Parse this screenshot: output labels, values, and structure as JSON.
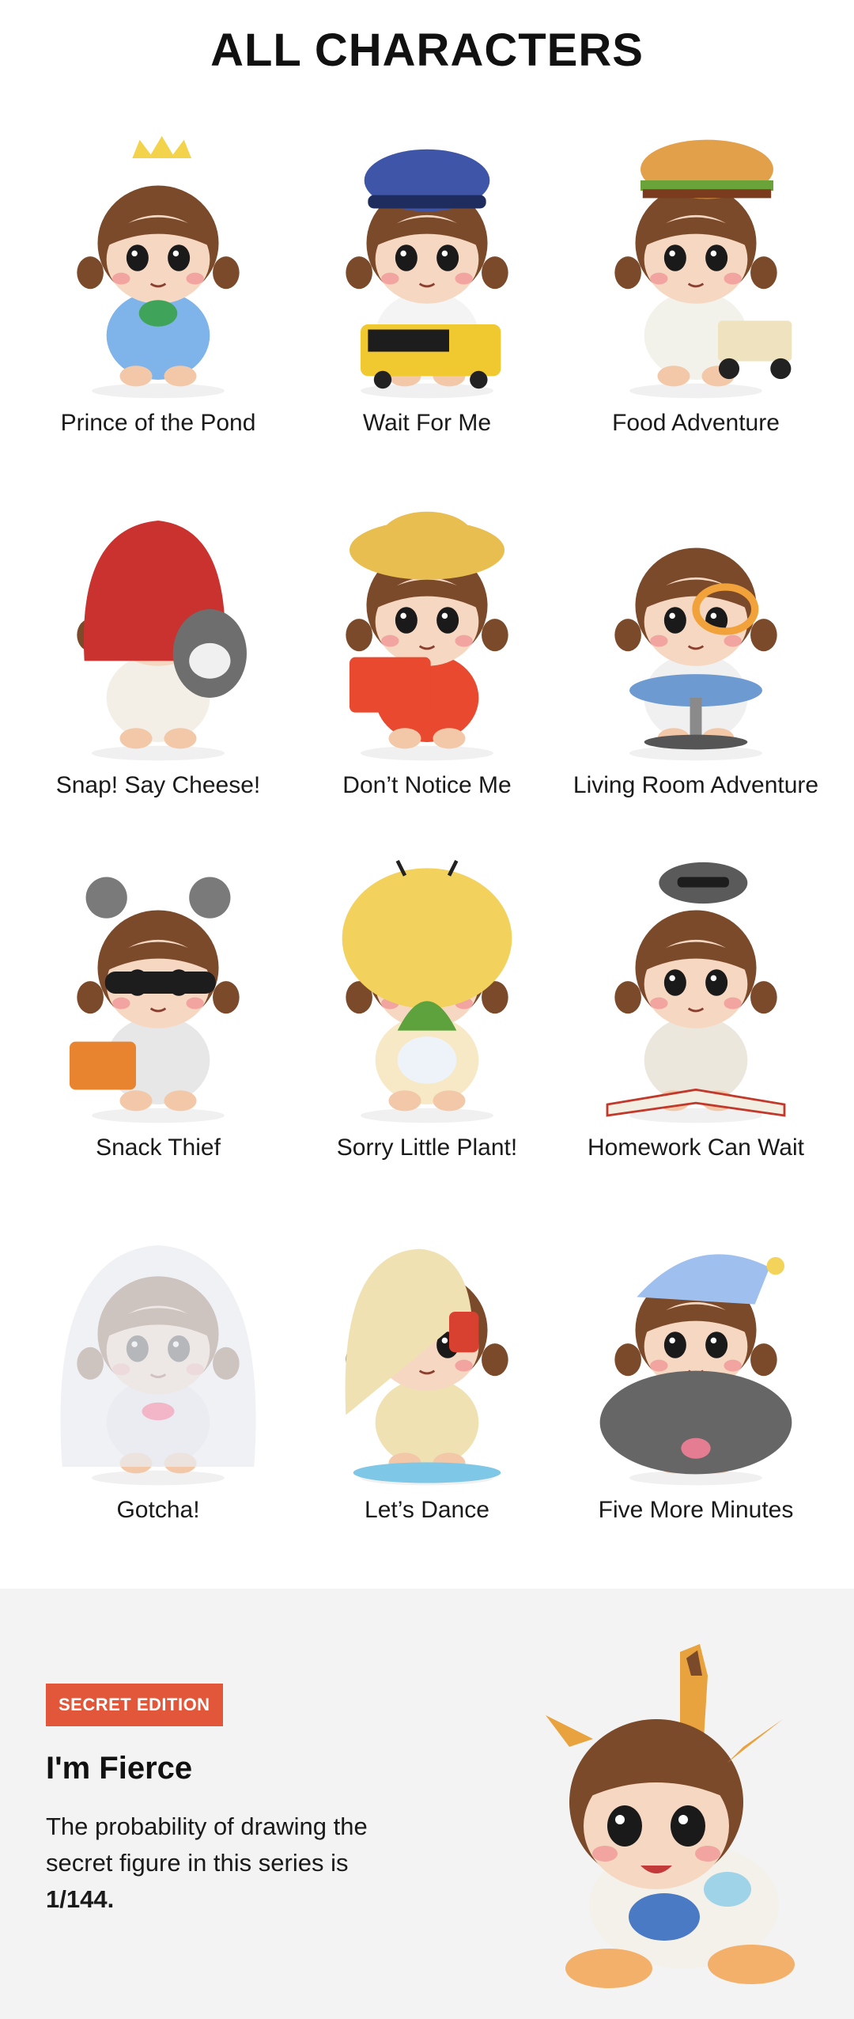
{
  "header": {
    "title": "ALL CHARACTERS"
  },
  "characters": [
    {
      "name": "Prince of the Pond",
      "accent": "#6fa6e0",
      "hat": "crown",
      "hat_color": "#f2d34b",
      "cloth": "#7fb4ea",
      "prop": "frog"
    },
    {
      "name": "Wait For Me",
      "accent": "#2e3f86",
      "hat": "cap",
      "hat_color": "#3e55a8",
      "cloth": "#f4f4f4",
      "prop": "bus"
    },
    {
      "name": "Food Adventure",
      "accent": "#e8a33b",
      "hat": "burger",
      "hat_color": "#e3a04a",
      "cloth": "#f2f2ea",
      "prop": "cart"
    },
    {
      "name": "Snap! Say Cheese!",
      "accent": "#c9322e",
      "hat": "hood",
      "hat_color": "#c9322e",
      "cloth": "#f3efe6",
      "prop": "wolf"
    },
    {
      "name": "Don’t Notice Me",
      "accent": "#f0c046",
      "hat": "straw",
      "hat_color": "#e9be50",
      "cloth": "#e8492f",
      "prop": "bag"
    },
    {
      "name": "Living Room Adventure",
      "accent": "#6d9ad1",
      "hat": "goggles",
      "hat_color": "#f2a23a",
      "cloth": "#f0f0f0",
      "prop": "chair"
    },
    {
      "name": "Snack Thief",
      "accent": "#777777",
      "hat": "raccoon",
      "hat_color": "#7a7a7a",
      "cloth": "#e7e7e7",
      "prop": "jar"
    },
    {
      "name": "Sorry Little Plant!",
      "accent": "#f3d35a",
      "hat": "bee",
      "hat_color": "#f2d15c",
      "cloth": "#f7e9c6",
      "prop": "plant"
    },
    {
      "name": "Homework Can Wait",
      "accent": "#555555",
      "hat": "raccoon-top",
      "hat_color": "#5a5a5a",
      "cloth": "#ece7dc",
      "prop": "book"
    },
    {
      "name": "Gotcha!",
      "accent": "#d9dde3",
      "hat": "ghost",
      "hat_color": "#e9ecf1",
      "cloth": "#e9ecf1",
      "prop": "sheet"
    },
    {
      "name": "Let’s Dance",
      "accent": "#efe3b9",
      "hat": "raincoat",
      "hat_color": "#efe1b2",
      "cloth": "#efe1b2",
      "prop": "puddle"
    },
    {
      "name": "Five More Minutes",
      "accent": "#8ab0e6",
      "hat": "nightcap",
      "hat_color": "#9fc0ee",
      "cloth": "#8db3e8",
      "prop": "pillow"
    }
  ],
  "secret": {
    "badge": "SECRET EDITION",
    "title": "I'm Fierce",
    "description": "The probability of drawing the secret figure in this series is",
    "odds": "1/144.",
    "badge_color": "#e2573a",
    "figure_hat_color": "#e8a23e"
  }
}
